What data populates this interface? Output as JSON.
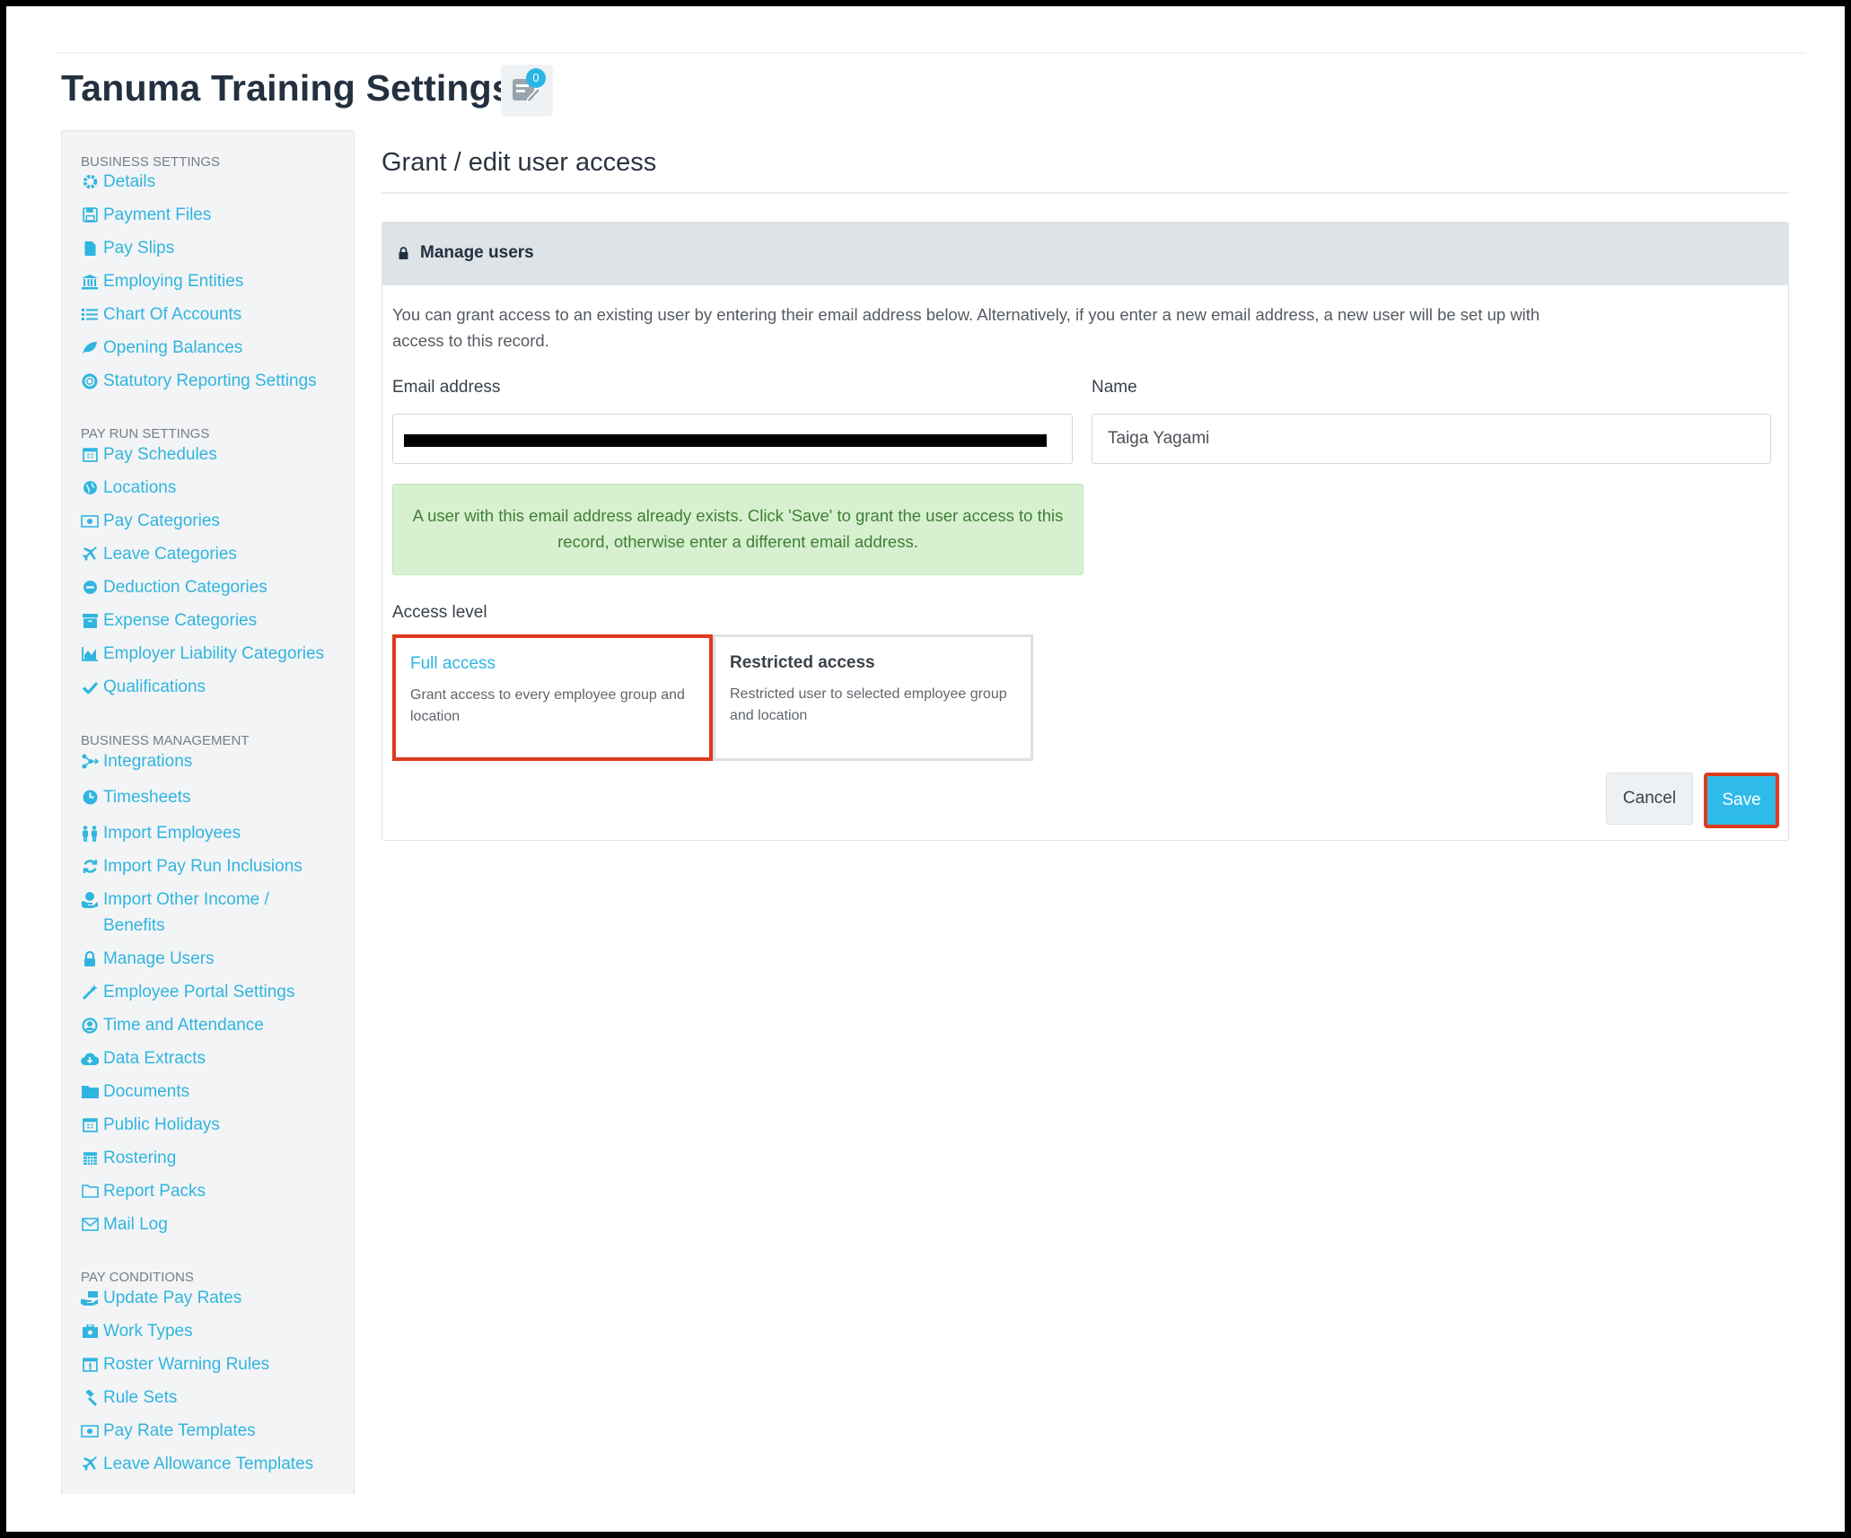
{
  "page": {
    "title": "Tanuma Training Settings",
    "notification_count": "0"
  },
  "sidebar": {
    "sections": [
      {
        "heading": "BUSINESS SETTINGS",
        "items": [
          {
            "label": "Details",
            "icon": "gear-icon"
          },
          {
            "label": "Payment Files",
            "icon": "floppy-disk-icon"
          },
          {
            "label": "Pay Slips",
            "icon": "file-icon"
          },
          {
            "label": "Employing Entities",
            "icon": "bank-icon"
          },
          {
            "label": "Chart Of Accounts",
            "icon": "list-icon"
          },
          {
            "label": "Opening Balances",
            "icon": "leaf-icon"
          },
          {
            "label": "Statutory Reporting Settings",
            "icon": "life-ring-icon"
          }
        ]
      },
      {
        "heading": "PAY RUN SETTINGS",
        "items": [
          {
            "label": "Pay Schedules",
            "icon": "calendar-icon"
          },
          {
            "label": "Locations",
            "icon": "globe-icon"
          },
          {
            "label": "Pay Categories",
            "icon": "money-icon"
          },
          {
            "label": "Leave Categories",
            "icon": "plane-icon"
          },
          {
            "label": "Deduction Categories",
            "icon": "minus-circle-icon"
          },
          {
            "label": "Expense Categories",
            "icon": "archive-icon"
          },
          {
            "label": "Employer Liability Categories",
            "icon": "area-chart-icon"
          },
          {
            "label": "Qualifications",
            "icon": "check-icon"
          }
        ]
      },
      {
        "heading": "BUSINESS MANAGEMENT",
        "items": [
          {
            "label": "Integrations",
            "icon": "share-nodes-icon"
          },
          {
            "label": "Timesheets",
            "icon": "clock-icon"
          },
          {
            "label": "Import Employees",
            "icon": "users-icon"
          },
          {
            "label": "Import Pay Run Inclusions",
            "icon": "refresh-icon"
          },
          {
            "label": "Import Other Income / Benefits",
            "icon": "hand-holding-icon"
          },
          {
            "label": "Manage Users",
            "icon": "lock-icon"
          },
          {
            "label": "Employee Portal Settings",
            "icon": "magic-wand-icon"
          },
          {
            "label": "Time and Attendance",
            "icon": "user-circle-icon"
          },
          {
            "label": "Data Extracts",
            "icon": "cloud-download-icon"
          },
          {
            "label": "Documents",
            "icon": "folder-icon"
          },
          {
            "label": "Public Holidays",
            "icon": "calendar-icon"
          },
          {
            "label": "Rostering",
            "icon": "calendar-grid-icon"
          },
          {
            "label": "Report Packs",
            "icon": "folder-open-icon"
          },
          {
            "label": "Mail Log",
            "icon": "envelope-icon"
          }
        ]
      },
      {
        "heading": "PAY CONDITIONS",
        "items": [
          {
            "label": "Update Pay Rates",
            "icon": "money-hand-icon"
          },
          {
            "label": "Work Types",
            "icon": "briefcase-icon"
          },
          {
            "label": "Roster Warning Rules",
            "icon": "calendar-warning-icon"
          },
          {
            "label": "Rule Sets",
            "icon": "gavel-icon"
          },
          {
            "label": "Pay Rate Templates",
            "icon": "money-icon"
          },
          {
            "label": "Leave Allowance Templates",
            "icon": "plane-icon"
          }
        ]
      }
    ]
  },
  "main": {
    "section_title": "Grant / edit user access",
    "panel_title": "Manage users",
    "intro": "You can grant access to an existing user by entering their email address below. Alternatively, if you enter a new email address, a new user will be set up with access to this record.",
    "email_label": "Email address",
    "email_value": "",
    "name_label": "Name",
    "name_value": "Taiga Yagami",
    "alert": "A user with this email address already exists. Click 'Save' to grant the user access to this record, otherwise enter a different email address.",
    "access_level_label": "Access level",
    "access_options": [
      {
        "title": "Full access",
        "description": "Grant access to every employee group and location",
        "selected": true
      },
      {
        "title": "Restricted access",
        "description": "Restricted user to selected employee group and location",
        "selected": false
      }
    ],
    "cancel_label": "Cancel",
    "save_label": "Save"
  },
  "colors": {
    "accent": "#2fb5e0",
    "highlight": "#de3b1e",
    "alert_bg": "#d7f0cf",
    "alert_text": "#3f7f35"
  }
}
